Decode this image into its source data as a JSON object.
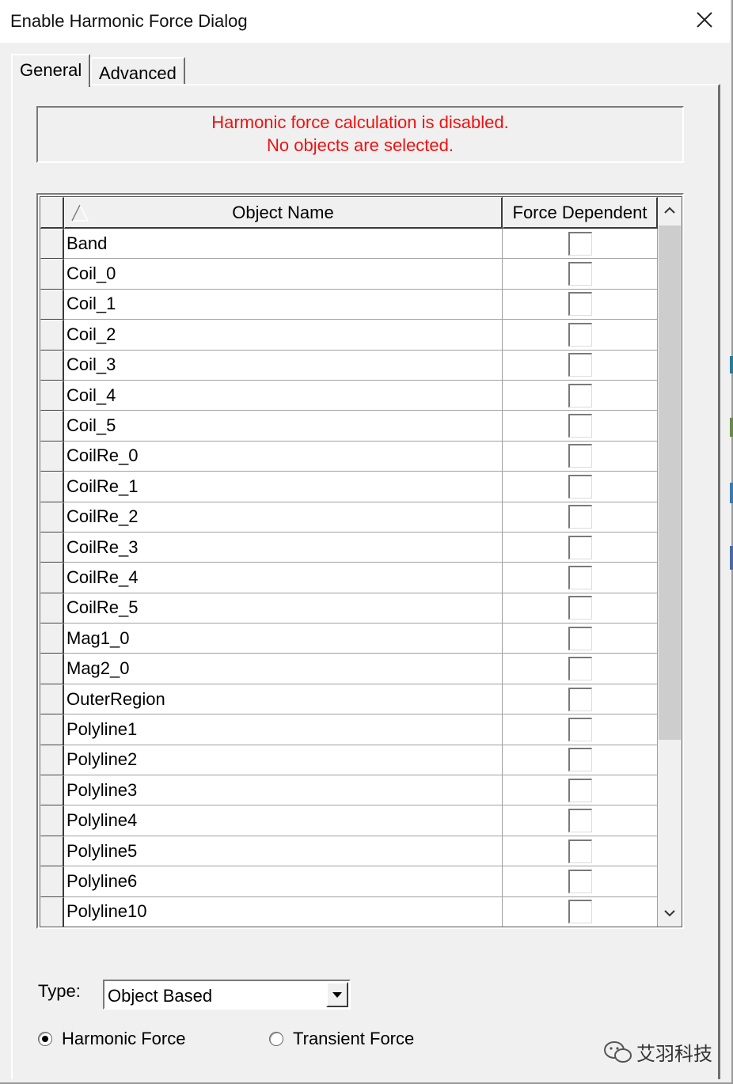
{
  "window": {
    "title": "Enable Harmonic Force Dialog"
  },
  "tabs": [
    {
      "label": "General",
      "active": true
    },
    {
      "label": "Advanced",
      "active": false
    }
  ],
  "message": {
    "line1": "Harmonic force calculation is disabled.",
    "line2": "No objects are selected.",
    "color": "#ee1111"
  },
  "grid": {
    "columns": {
      "name": "Object Name",
      "force": "Force Dependent"
    },
    "rows": [
      {
        "name": "Band",
        "force_dependent": false
      },
      {
        "name": "Coil_0",
        "force_dependent": false
      },
      {
        "name": "Coil_1",
        "force_dependent": false
      },
      {
        "name": "Coil_2",
        "force_dependent": false
      },
      {
        "name": "Coil_3",
        "force_dependent": false
      },
      {
        "name": "Coil_4",
        "force_dependent": false
      },
      {
        "name": "Coil_5",
        "force_dependent": false
      },
      {
        "name": "CoilRe_0",
        "force_dependent": false
      },
      {
        "name": "CoilRe_1",
        "force_dependent": false
      },
      {
        "name": "CoilRe_2",
        "force_dependent": false
      },
      {
        "name": "CoilRe_3",
        "force_dependent": false
      },
      {
        "name": "CoilRe_4",
        "force_dependent": false
      },
      {
        "name": "CoilRe_5",
        "force_dependent": false
      },
      {
        "name": "Mag1_0",
        "force_dependent": false
      },
      {
        "name": "Mag2_0",
        "force_dependent": false
      },
      {
        "name": "OuterRegion",
        "force_dependent": false
      },
      {
        "name": "Polyline1",
        "force_dependent": false
      },
      {
        "name": "Polyline2",
        "force_dependent": false
      },
      {
        "name": "Polyline3",
        "force_dependent": false
      },
      {
        "name": "Polyline4",
        "force_dependent": false
      },
      {
        "name": "Polyline5",
        "force_dependent": false
      },
      {
        "name": "Polyline6",
        "force_dependent": false
      },
      {
        "name": "Polyline10",
        "force_dependent": false
      }
    ]
  },
  "type": {
    "label": "Type:",
    "value": "Object Based"
  },
  "radios": {
    "harmonic": {
      "label": "Harmonic Force",
      "selected": true
    },
    "transient": {
      "label": "Transient Force",
      "selected": false
    }
  },
  "watermark": {
    "text": "艾羽科技"
  }
}
